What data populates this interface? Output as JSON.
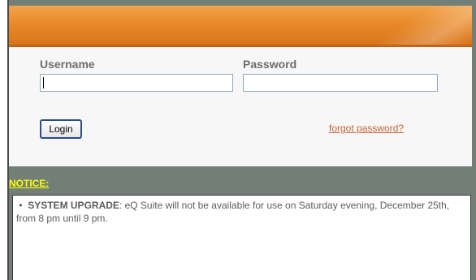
{
  "login": {
    "username_label": "Username",
    "password_label": "Password",
    "username_value": "",
    "password_value": "",
    "login_button": "Login",
    "forgot_link": "forgot password?"
  },
  "notice": {
    "title": "NOTICE:",
    "bullet": "•",
    "headline": "SYSTEM UPGRADE",
    "body": ": eQ Suite will not be available for use on Saturday evening, December 25th, from 8 pm until 9 pm."
  },
  "colors": {
    "header_orange": "#e98a2a",
    "frame_gray": "#717f78",
    "notice_yellow": "#ffff00",
    "link_color": "#c8623a"
  }
}
